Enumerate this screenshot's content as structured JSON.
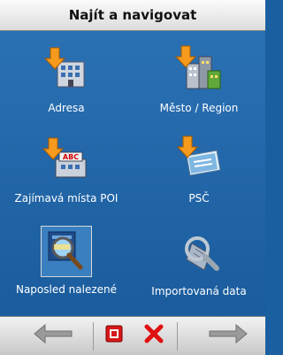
{
  "window": {
    "title": "Najít a navigovat"
  },
  "menu": {
    "items": [
      {
        "label": "Adresa",
        "icon": "building-arrow-icon"
      },
      {
        "label": "Město / Region",
        "icon": "city-arrow-icon"
      },
      {
        "label": "Zajímavá místa POI",
        "icon": "poi-arrow-icon"
      },
      {
        "label": "PSČ",
        "icon": "postcode-arrow-icon"
      },
      {
        "label": "Naposled nalezené",
        "icon": "recent-search-icon"
      },
      {
        "label": "Importovaná data",
        "icon": "imported-data-icon"
      }
    ],
    "selected_index": 4
  },
  "toolbar": {
    "back_icon": "arrow-left-icon",
    "map_icon": "map-icon",
    "cancel_icon": "close-icon",
    "forward_icon": "arrow-right-icon"
  },
  "colors": {
    "background": "#1a5fa0",
    "title_bar": "#e8e8e8",
    "accent_red": "#e01010"
  }
}
